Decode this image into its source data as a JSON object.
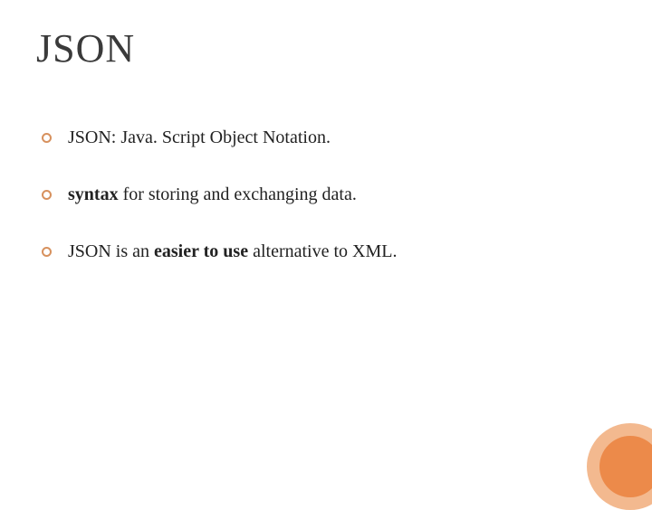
{
  "slide": {
    "title": "JSON",
    "bullets": [
      {
        "segments": [
          {
            "text": "JSON: Java. Script Object Notation.",
            "bold": false
          }
        ]
      },
      {
        "segments": [
          {
            "text": "syntax",
            "bold": true
          },
          {
            "text": " for storing and exchanging data.",
            "bold": false
          }
        ]
      },
      {
        "segments": [
          {
            "text": "JSON is an ",
            "bold": false
          },
          {
            "text": "easier to use",
            "bold": true
          },
          {
            "text": " alternative to XML.",
            "bold": false
          }
        ]
      }
    ]
  },
  "colors": {
    "accent_outer": "#f3b98f",
    "accent_inner": "#ec8a4a",
    "bullet_ring": "#d7915e"
  }
}
